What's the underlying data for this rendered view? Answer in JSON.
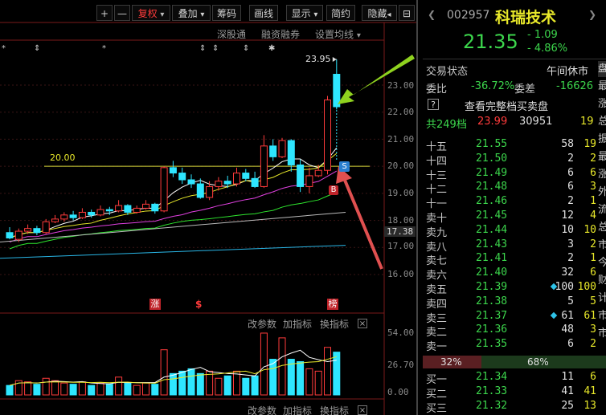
{
  "toolbar": {
    "plus": "+",
    "minus": "—",
    "fuquan": "复权",
    "fuquan_arrow": "▾",
    "diejia": "叠加",
    "diejia_arrow": "▾",
    "chouma": "筹码",
    "huaxian": "画线",
    "xianshi": "显示",
    "xianshi_arrow": "▾",
    "jianyue": "简约",
    "yincang": "隐藏",
    "yincang_arrow": "◂",
    "expand": "⊟"
  },
  "subbar": {
    "shengutong": "深股通",
    "rongzi": "融资融券",
    "shezhi": "设置均线",
    "shezhi_arrow": "▾"
  },
  "main_chart": {
    "max_label": "23.95",
    "hline_label": "20.00",
    "current_price_tag": "17.38",
    "markers": [
      "涨",
      "$",
      "榜"
    ],
    "s_badge": "S",
    "b_badge": "B",
    "y_ticks": [
      "23.00",
      "22.00",
      "21.00",
      "20.00",
      "19.00",
      "18.00",
      "17.00",
      "16.00"
    ]
  },
  "indicator_bar": {
    "gaicanshu": "改参数",
    "jiazhibiao": "加指标",
    "huanzhibiao": "换指标",
    "close": "×"
  },
  "vol_ticks": [
    "54.00",
    "26.70",
    "0.00"
  ],
  "bottom_bar": {
    "gaicanshu": "改参数",
    "jiazhibiao": "加指标",
    "huanzhibiao": "换指标",
    "close": "×"
  },
  "stock": {
    "code": "002957",
    "name": "科瑞技术",
    "price": "21.35",
    "change": "- 1.09",
    "change_pct": "- 4.86%"
  },
  "trade_state": {
    "label": "交易状态",
    "value": "午间休市",
    "side_tab": "盘"
  },
  "weibi": {
    "label": "委比",
    "value": "-36.72%",
    "label2": "委差",
    "value2": "-16626"
  },
  "full_book": {
    "icon": "?",
    "label": "查看完整档买卖盘"
  },
  "total": {
    "label": "共249档",
    "price": "23.99",
    "vol": "30951",
    "cnt": "19"
  },
  "asks": [
    {
      "name": "十五",
      "price": "21.55",
      "vol": "58",
      "cnt": "19",
      "diamond": false
    },
    {
      "name": "十四",
      "price": "21.50",
      "vol": "2",
      "cnt": "2",
      "diamond": false
    },
    {
      "name": "十三",
      "price": "21.49",
      "vol": "6",
      "cnt": "6",
      "diamond": false
    },
    {
      "name": "十二",
      "price": "21.48",
      "vol": "6",
      "cnt": "3",
      "diamond": false
    },
    {
      "name": "十一",
      "price": "21.46",
      "vol": "2",
      "cnt": "1",
      "diamond": false
    },
    {
      "name": "卖十",
      "price": "21.45",
      "vol": "12",
      "cnt": "4",
      "diamond": false
    },
    {
      "name": "卖九",
      "price": "21.44",
      "vol": "10",
      "cnt": "10",
      "diamond": false
    },
    {
      "name": "卖八",
      "price": "21.43",
      "vol": "3",
      "cnt": "2",
      "diamond": false
    },
    {
      "name": "卖七",
      "price": "21.41",
      "vol": "2",
      "cnt": "1",
      "diamond": false
    },
    {
      "name": "卖六",
      "price": "21.40",
      "vol": "32",
      "cnt": "6",
      "diamond": false
    },
    {
      "name": "卖五",
      "price": "21.39",
      "vol": "100",
      "cnt": "100",
      "diamond": true
    },
    {
      "name": "卖四",
      "price": "21.38",
      "vol": "5",
      "cnt": "5",
      "diamond": false
    },
    {
      "name": "卖三",
      "price": "21.37",
      "vol": "61",
      "cnt": "61",
      "diamond": true
    },
    {
      "name": "卖二",
      "price": "21.36",
      "vol": "48",
      "cnt": "3",
      "diamond": false
    },
    {
      "name": "卖一",
      "price": "21.35",
      "vol": "6",
      "cnt": "2",
      "diamond": false
    }
  ],
  "ratio": {
    "left": "32%",
    "right": "68%",
    "left_frac": 0.32
  },
  "bids": [
    {
      "name": "买一",
      "price": "21.34",
      "vol": "11",
      "cnt": "6"
    },
    {
      "name": "买二",
      "price": "21.33",
      "vol": "41",
      "cnt": "41"
    },
    {
      "name": "买三",
      "price": "21.32",
      "vol": "25",
      "cnt": "13"
    }
  ],
  "side_chars": [
    "最",
    "涨",
    "总",
    "振",
    "最",
    "涨",
    "外",
    "流",
    "总",
    "市",
    "今",
    "财",
    "计",
    "市",
    "市"
  ],
  "candles": [
    {
      "o": 17.55,
      "c": 17.35,
      "h": 17.75,
      "l": 17.3
    },
    {
      "o": 17.3,
      "c": 17.6,
      "h": 17.7,
      "l": 17.2
    },
    {
      "o": 17.6,
      "c": 17.7,
      "h": 17.85,
      "l": 17.5
    },
    {
      "o": 17.7,
      "c": 17.55,
      "h": 17.8,
      "l": 17.45
    },
    {
      "o": 17.55,
      "c": 17.95,
      "h": 18.05,
      "l": 17.5
    },
    {
      "o": 17.95,
      "c": 18.05,
      "h": 18.2,
      "l": 17.9
    },
    {
      "o": 18.05,
      "c": 18.2,
      "h": 18.3,
      "l": 17.95
    },
    {
      "o": 18.2,
      "c": 18.1,
      "h": 18.35,
      "l": 18.0
    },
    {
      "o": 18.1,
      "c": 18.3,
      "h": 18.45,
      "l": 18.05
    },
    {
      "o": 18.3,
      "c": 18.2,
      "h": 18.4,
      "l": 18.1
    },
    {
      "o": 18.2,
      "c": 18.4,
      "h": 18.55,
      "l": 18.15
    },
    {
      "o": 18.4,
      "c": 18.35,
      "h": 18.5,
      "l": 18.2
    },
    {
      "o": 18.35,
      "c": 18.55,
      "h": 18.75,
      "l": 18.3
    },
    {
      "o": 18.55,
      "c": 18.3,
      "h": 18.6,
      "l": 18.2
    },
    {
      "o": 18.3,
      "c": 18.45,
      "h": 18.55,
      "l": 18.25
    },
    {
      "o": 18.45,
      "c": 18.6,
      "h": 18.75,
      "l": 18.4
    },
    {
      "o": 18.6,
      "c": 18.35,
      "h": 18.65,
      "l": 18.25
    },
    {
      "o": 18.35,
      "c": 19.95,
      "h": 20.0,
      "l": 18.3
    },
    {
      "o": 19.95,
      "c": 19.75,
      "h": 20.2,
      "l": 19.6
    },
    {
      "o": 19.75,
      "c": 19.5,
      "h": 19.95,
      "l": 19.35
    },
    {
      "o": 19.5,
      "c": 19.35,
      "h": 19.7,
      "l": 19.2
    },
    {
      "o": 19.35,
      "c": 18.85,
      "h": 19.55,
      "l": 18.8
    },
    {
      "o": 18.85,
      "c": 19.25,
      "h": 19.45,
      "l": 18.75
    },
    {
      "o": 19.25,
      "c": 19.45,
      "h": 19.6,
      "l": 19.1
    },
    {
      "o": 19.45,
      "c": 19.35,
      "h": 19.65,
      "l": 19.2
    },
    {
      "o": 19.35,
      "c": 19.75,
      "h": 19.95,
      "l": 19.25
    },
    {
      "o": 19.75,
      "c": 19.55,
      "h": 19.9,
      "l": 19.45
    },
    {
      "o": 19.55,
      "c": 19.25,
      "h": 19.8,
      "l": 19.2
    },
    {
      "o": 19.25,
      "c": 20.75,
      "h": 21.15,
      "l": 19.2
    },
    {
      "o": 20.75,
      "c": 20.35,
      "h": 21.0,
      "l": 20.2
    },
    {
      "o": 20.35,
      "c": 20.95,
      "h": 21.05,
      "l": 20.3
    },
    {
      "o": 20.95,
      "c": 20.05,
      "h": 21.0,
      "l": 19.8
    },
    {
      "o": 20.05,
      "c": 19.25,
      "h": 20.25,
      "l": 19.05
    },
    {
      "o": 19.25,
      "c": 19.65,
      "h": 19.95,
      "l": 19.0
    },
    {
      "o": 19.65,
      "c": 19.85,
      "h": 20.05,
      "l": 19.6
    },
    {
      "o": 19.85,
      "c": 22.45,
      "h": 22.6,
      "l": 19.7
    },
    {
      "o": 23.4,
      "c": 22.2,
      "h": 23.95,
      "l": 22.1
    }
  ],
  "volumes": [
    8,
    12,
    11,
    9,
    14,
    12,
    10,
    9,
    11,
    8,
    10,
    9,
    15,
    10,
    8,
    10,
    9,
    38,
    18,
    20,
    22,
    18,
    20,
    14,
    16,
    20,
    14,
    16,
    52,
    30,
    48,
    30,
    28,
    22,
    20,
    40,
    36
  ],
  "vol_up": [
    false,
    true,
    true,
    false,
    true,
    true,
    true,
    false,
    true,
    false,
    true,
    false,
    true,
    false,
    true,
    true,
    false,
    true,
    false,
    false,
    false,
    false,
    true,
    true,
    false,
    true,
    false,
    false,
    true,
    false,
    true,
    false,
    false,
    true,
    true,
    true,
    false
  ]
}
